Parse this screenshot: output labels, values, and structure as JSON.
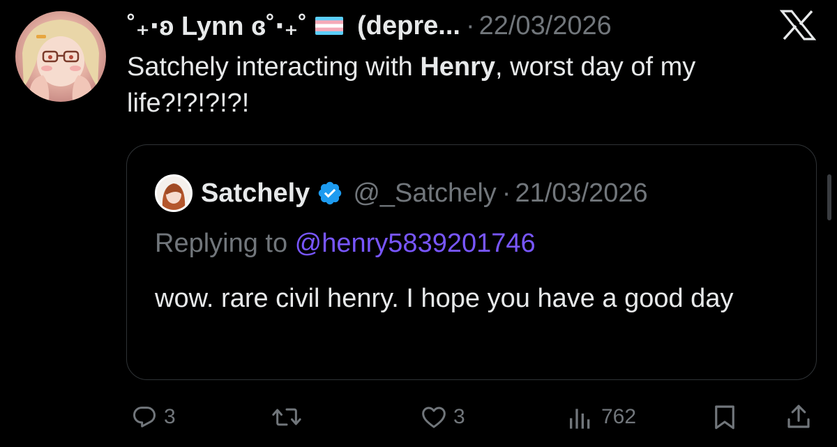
{
  "tweet": {
    "author_prefix": "˚₊‧ʚ Lynn ɞ˚‧₊˚",
    "author_suffix": "(depre...",
    "date": "22/03/2026",
    "text_before": "Satchely interacting with ",
    "text_bold": "Henry",
    "text_after": ", worst day of my life?!?!?!?!"
  },
  "quoted": {
    "name": "Satchely",
    "handle": "@_Satchely",
    "date": "21/03/2026",
    "replying_label": "Replying to ",
    "replying_mention": "@henry5839201746",
    "text": "wow. rare civil henry. I hope you have a good day"
  },
  "actions": {
    "replies": "3",
    "likes": "3",
    "views": "762"
  },
  "colors": {
    "background": "#000000",
    "text": "#e7e9ea",
    "secondary": "#71767b",
    "mention": "#7856ff",
    "verified": "#1d9bf0",
    "border": "#2f3336"
  },
  "icons": [
    "x-logo-icon",
    "verified-badge-icon",
    "reply-icon",
    "retweet-icon",
    "like-icon",
    "views-icon",
    "bookmark-icon",
    "share-icon",
    "trans-flag-icon"
  ]
}
